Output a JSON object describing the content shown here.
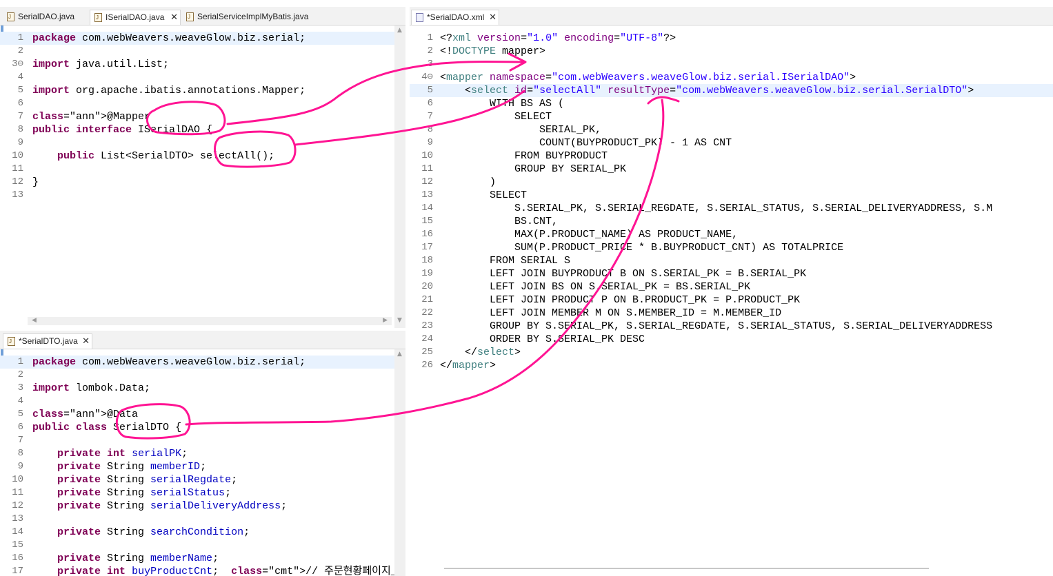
{
  "top_left_tabs": [
    {
      "label": "SerialDAO.java"
    },
    {
      "label": "ISerialDAO.java"
    },
    {
      "label": "SerialServiceImplMyBatis.java"
    }
  ],
  "bottom_left_tabs": [
    {
      "label": "*SerialDTO.java"
    }
  ],
  "right_tabs": [
    {
      "label": "*SerialDAO.xml"
    }
  ],
  "close_glyph": "✕",
  "java_icon_letter": "J",
  "idao_lines": [
    {
      "n": "1",
      "t": "package com.webWeavers.weaveGlow.biz.serial;"
    },
    {
      "n": "2",
      "t": ""
    },
    {
      "n": "3⊖",
      "t": "import java.util.List;"
    },
    {
      "n": "4",
      "t": ""
    },
    {
      "n": "5",
      "t": "import org.apache.ibatis.annotations.Mapper;"
    },
    {
      "n": "6",
      "t": ""
    },
    {
      "n": "7",
      "t": "@Mapper"
    },
    {
      "n": "8",
      "t": "public interface ISerialDAO {"
    },
    {
      "n": "9",
      "t": ""
    },
    {
      "n": "10",
      "t": "    public List<SerialDTO> selectAll();"
    },
    {
      "n": "11",
      "t": ""
    },
    {
      "n": "12",
      "t": "}"
    },
    {
      "n": "13",
      "t": ""
    }
  ],
  "dto_lines": [
    {
      "n": "1",
      "t": "package com.webWeavers.weaveGlow.biz.serial;"
    },
    {
      "n": "2",
      "t": ""
    },
    {
      "n": "3",
      "t": "import lombok.Data;"
    },
    {
      "n": "4",
      "t": ""
    },
    {
      "n": "5",
      "t": "@Data"
    },
    {
      "n": "6",
      "t": "public class SerialDTO {"
    },
    {
      "n": "7",
      "t": ""
    },
    {
      "n": "8",
      "t": "    private int serialPK;"
    },
    {
      "n": "9",
      "t": "    private String memberID;"
    },
    {
      "n": "10",
      "t": "    private String serialRegdate;"
    },
    {
      "n": "11",
      "t": "    private String serialStatus;"
    },
    {
      "n": "12",
      "t": "    private String serialDeliveryAddress;"
    },
    {
      "n": "13",
      "t": ""
    },
    {
      "n": "14",
      "t": "    private String searchCondition;"
    },
    {
      "n": "15",
      "t": ""
    },
    {
      "n": "16",
      "t": "    private String memberName;"
    },
    {
      "n": "17",
      "t": "    private int buyProductCnt;  // 주문현황페이지_~~ 상품 ?"
    }
  ],
  "xml_lines": [
    {
      "n": "1",
      "t": "<?xml version=\"1.0\" encoding=\"UTF-8\"?>"
    },
    {
      "n": "2",
      "t": "<!DOCTYPE mapper>"
    },
    {
      "n": "3",
      "t": ""
    },
    {
      "n": "4⊖",
      "t": "<mapper namespace=\"com.webWeavers.weaveGlow.biz.serial.ISerialDAO\">"
    },
    {
      "n": "5",
      "t": "    <select id=\"selectAll\" resultType=\"com.webWeavers.weaveGlow.biz.serial.SerialDTO\">"
    },
    {
      "n": "6",
      "t": "        WITH BS AS ("
    },
    {
      "n": "7",
      "t": "            SELECT"
    },
    {
      "n": "8",
      "t": "                SERIAL_PK,"
    },
    {
      "n": "9",
      "t": "                COUNT(BUYPRODUCT_PK) - 1 AS CNT"
    },
    {
      "n": "10",
      "t": "            FROM BUYPRODUCT"
    },
    {
      "n": "11",
      "t": "            GROUP BY SERIAL_PK"
    },
    {
      "n": "12",
      "t": "        )"
    },
    {
      "n": "13",
      "t": "        SELECT"
    },
    {
      "n": "14",
      "t": "            S.SERIAL_PK, S.SERIAL_REGDATE, S.SERIAL_STATUS, S.SERIAL_DELIVERYADDRESS, S.M"
    },
    {
      "n": "15",
      "t": "            BS.CNT,"
    },
    {
      "n": "16",
      "t": "            MAX(P.PRODUCT_NAME) AS PRODUCT_NAME,"
    },
    {
      "n": "17",
      "t": "            SUM(P.PRODUCT_PRICE * B.BUYPRODUCT_CNT) AS TOTALPRICE"
    },
    {
      "n": "18",
      "t": "        FROM SERIAL S"
    },
    {
      "n": "19",
      "t": "        LEFT JOIN BUYPRODUCT B ON S.SERIAL_PK = B.SERIAL_PK"
    },
    {
      "n": "20",
      "t": "        LEFT JOIN BS ON S.SERIAL_PK = BS.SERIAL_PK"
    },
    {
      "n": "21",
      "t": "        LEFT JOIN PRODUCT P ON B.PRODUCT_PK = P.PRODUCT_PK"
    },
    {
      "n": "22",
      "t": "        LEFT JOIN MEMBER M ON S.MEMBER_ID = M.MEMBER_ID"
    },
    {
      "n": "23",
      "t": "        GROUP BY S.SERIAL_PK, S.SERIAL_REGDATE, S.SERIAL_STATUS, S.SERIAL_DELIVERYADDRESS"
    },
    {
      "n": "24",
      "t": "        ORDER BY S.SERIAL_PK DESC"
    },
    {
      "n": "25",
      "t": "    </select>"
    },
    {
      "n": "26",
      "t": "</mapper>"
    }
  ],
  "colors": {
    "annotation_pink": "#ff1493",
    "keyword": "#7f0055",
    "field": "#0000c0",
    "comment": "#3f7f5f",
    "xml_tag": "#3f7f7f",
    "xml_attr": "#7f007f",
    "xml_value": "#2a00ff",
    "current_line": "#e8f2fe"
  }
}
